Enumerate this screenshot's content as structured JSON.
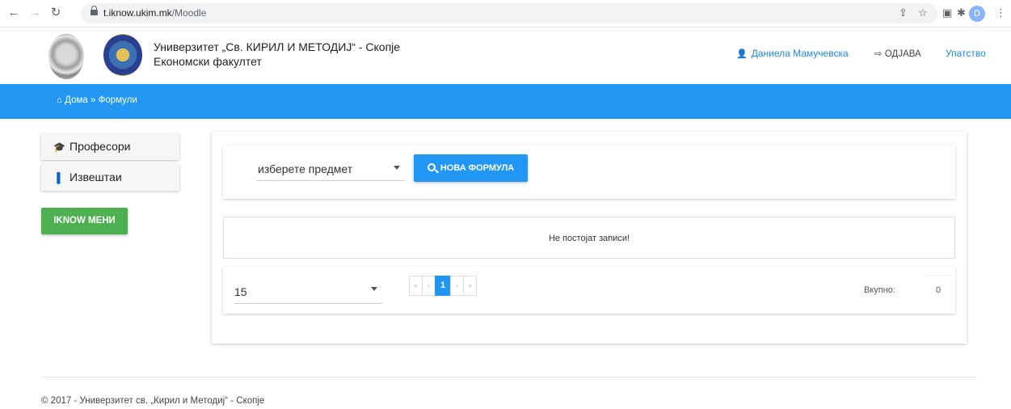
{
  "browser": {
    "url_host": "t.iknow.ukim.mk",
    "url_path": "/Moodle",
    "profile_initial": "D"
  },
  "header": {
    "university": "Универзитет „Св. КИРИЛ И МЕТОДИЈ“ - Скопје",
    "faculty": "Економски факултет",
    "user_name": "Даниела Мамучевска",
    "logout_label": "ОДЈАВА",
    "help_label": "Упатство"
  },
  "breadcrumb": {
    "home": "Дома",
    "current": "Формули"
  },
  "sidebar": {
    "items": [
      {
        "label": "Професори",
        "icon": "graduation-cap-icon"
      },
      {
        "label": "Извештаи",
        "icon": "bar-chart-icon"
      }
    ],
    "iknow_button": "IKNOW МЕНИ"
  },
  "filter": {
    "subject_placeholder": "изберете предмет",
    "new_formula_button": "НОВА ФОРМУЛА"
  },
  "records": {
    "empty_message": "Не постојат записи!"
  },
  "pagination": {
    "page_size": "15",
    "current_page": "1",
    "total_label": "Вкупно:",
    "total_value": "0"
  },
  "footer": {
    "copyright": "© 2017 - Универзитет св. „Кирил и Методиј“ - Скопје"
  },
  "colors": {
    "primary_blue": "#2196f3",
    "green": "#4caf50",
    "link_blue": "#1e88e5"
  }
}
